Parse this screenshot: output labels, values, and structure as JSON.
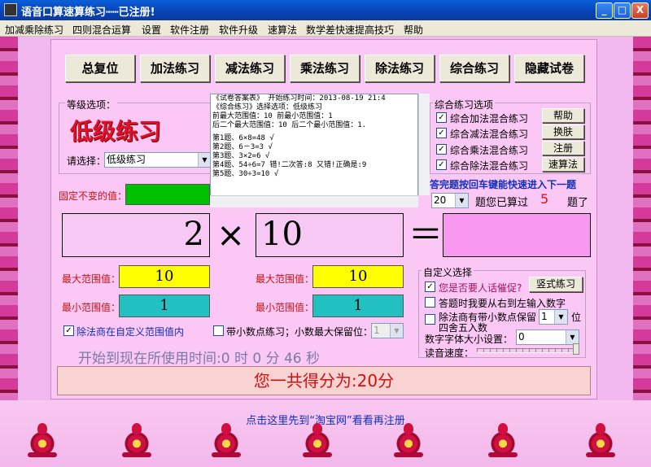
{
  "window": {
    "title": "语音口算速算练习┅┅已注册!",
    "min_label": "_",
    "max_label": "□",
    "close_label": "X"
  },
  "menu": [
    "加减乘除练习",
    "四则混合运算",
    "设置",
    "软件注册",
    "软件升级",
    "速算法",
    "数学差快速提高技巧",
    "帮助"
  ],
  "toolbar": [
    "总复位",
    "加法练习",
    "减法练习",
    "乘法练习",
    "除法练习",
    "综合练习",
    "隐藏试卷"
  ],
  "level": {
    "group_label": "等级选项：",
    "big_text": "低级练习",
    "select_label": "请选择：",
    "select_value": "低级练习"
  },
  "log_lines": [
    "《试卷答案表》 开始练习时间：2013-08-19 21:4",
    "《综合练习》选择选项：低级练习",
    "  前最大范围值：10  前最小范围值：1",
    "后二个最大范围值：10  后二个最小范围值：1.",
    "",
    "第1题、6×8=48 √",
    "第2题、6－3=3  √",
    "第3题、3×2=6  √",
    "第4题、54÷6=7  错!二次答:8 又错!正确是:9",
    "第5题、30÷3=10 √"
  ],
  "mixed": {
    "group_label": "综合练习选项",
    "options": [
      {
        "label": "综合加法混合练习",
        "checked": "✓",
        "button": "帮助"
      },
      {
        "label": "综合减法混合练习",
        "checked": "✓",
        "button": "换肤"
      },
      {
        "label": "综合乘法混合练习",
        "checked": "✓",
        "button": "注册"
      },
      {
        "label": "综合除法混合练习",
        "checked": "✓",
        "button": "速算法"
      }
    ],
    "hint": "答完题按回车键能快速进入下一题",
    "count_select": "20",
    "count_prefix": "题您已算过",
    "count_value": "5",
    "count_suffix": "题了"
  },
  "fixed_label": "固定不变的值：",
  "equation": {
    "left": "2",
    "op": "×",
    "right": "10",
    "eq": "＝",
    "answer": ""
  },
  "ranges": {
    "left_max_label": "最大范围值：",
    "left_max": "10",
    "left_min_label": "最小范围值：",
    "left_min": "1",
    "right_max_label": "最大范围值：",
    "right_max": "10",
    "right_min_label": "最小范围值：",
    "right_min": "1"
  },
  "options": {
    "div_custom": "除法商在自定义范围值内",
    "div_custom_checked": "✓",
    "decimal": "带小数点练习；小数最大保留位：",
    "decimal_checked": "",
    "decimal_select": "1"
  },
  "custom": {
    "group_label": "自定义选择",
    "urge_label": "您是否要人话催促?",
    "urge_checked": "✓",
    "vertical_btn": "竖式练习",
    "rtl_label": "答题时我要从右到左输入数字",
    "rtl_checked": "",
    "round_label": "除法商有带小数点保留",
    "round_label2": "四舍五入数",
    "round_checked": "",
    "round_select": "1",
    "round_unit": "位",
    "font_label": "数字字体大小设置：",
    "font_select": "0",
    "speed_label": "读音速度："
  },
  "timer": "开始到现在所使用时间:0 时 0 分 46 秒",
  "score": "您一共得分为:20分",
  "footer_link": "点击这里先到“淘宝网”看看再注册",
  "colors": {
    "background": "#f4b8f0",
    "panel": "#fbc8f5",
    "accent_red": "#e0102a",
    "yellow": "#ffff00",
    "teal": "#22c0c0",
    "green": "#00c000"
  }
}
